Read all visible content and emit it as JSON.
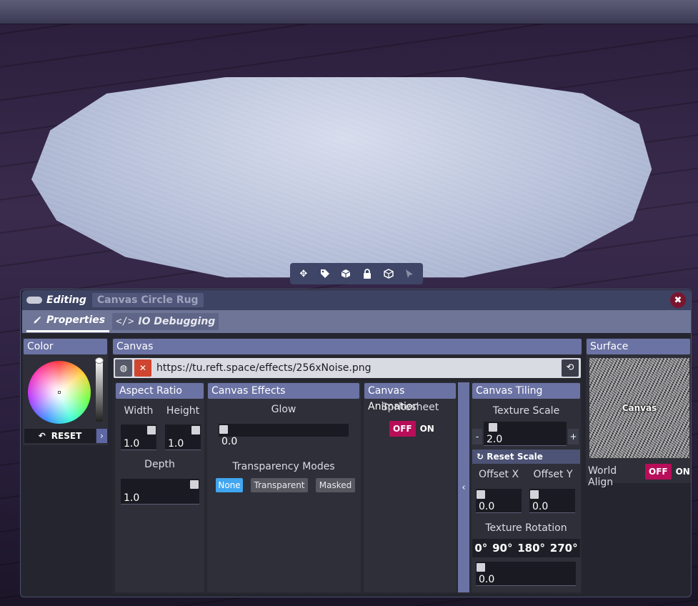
{
  "toolbar": {
    "icons": [
      "move-icon",
      "tag-icon",
      "cube-physics-icon",
      "lock-icon",
      "cube-icon",
      "cursor-icon"
    ]
  },
  "window": {
    "title": "Editing",
    "object_name": "Canvas Circle Rug"
  },
  "tabs": [
    {
      "label": "Properties",
      "active": true
    },
    {
      "label": "IO Debugging",
      "active": false
    }
  ],
  "color": {
    "header": "Color",
    "reset_label": "RESET"
  },
  "canvas": {
    "header": "Canvas",
    "url": "https://tu.reft.space/effects/256xNoise.png"
  },
  "aspect": {
    "header": "Aspect Ratio",
    "width_label": "Width",
    "height_label": "Height",
    "width_value": "1.0",
    "height_value": "1.0",
    "depth_label": "Depth",
    "depth_value": "1.0"
  },
  "effects": {
    "header": "Canvas Effects",
    "glow_label": "Glow",
    "glow_value": "0.0",
    "transparency_label": "Transparency Modes",
    "modes": [
      "None",
      "Transparent",
      "Masked"
    ],
    "selected_mode": "None"
  },
  "animation": {
    "header": "Canvas Animation",
    "spritesheet_label": "Spritesheet",
    "off_label": "OFF",
    "on_label": "ON"
  },
  "tiling": {
    "header": "Canvas Tiling",
    "scale_label": "Texture Scale",
    "scale_value": "2.0",
    "minus": "-",
    "plus": "+",
    "reset_scale": "Reset Scale",
    "offset_x_label": "Offset X",
    "offset_y_label": "Offset Y",
    "offset_x_value": "0.0",
    "offset_y_value": "0.0",
    "rotation_label": "Texture Rotation",
    "rotations": [
      "0°",
      "90°",
      "180°",
      "270°"
    ],
    "rotation_value": "0.0"
  },
  "surface": {
    "header": "Surface",
    "preview_label": "Canvas",
    "world_align_label": "World Align",
    "off_label": "OFF",
    "on_label": "ON"
  },
  "colors": {
    "accent": "#6b73a4",
    "off_toggle": "#b80e59",
    "selected_mode": "#41a6f0",
    "close": "#7a1530"
  }
}
